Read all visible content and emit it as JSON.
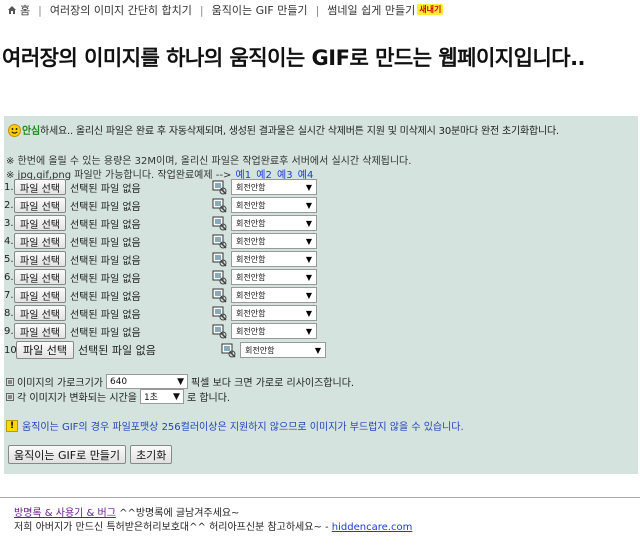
{
  "nav": {
    "items": [
      "홈",
      "여러장의 이미지 간단히 합치기",
      "움직이는 GIF 만들기",
      "썸네일 쉽게 만들기"
    ],
    "separator": "|",
    "badge": "새내기"
  },
  "headline": "여러장의 이미지를 하나의 움직이는 GIF로 만드는 웹페이지입니다..",
  "notice": {
    "greeting": "안심",
    "text": "하세요.. 올리신 파일은 완료 후 자동삭제되며, 생성된 결과물은 실시간 삭제버튼 지원 및 미삭제시 30분마다 완전 초기화합니다."
  },
  "info": {
    "line1": "※ 한번에 올릴 수 있는 용량은 32M이며, 올리신 파일은 작업완료후 서버에서 실시간 삭제됩니다.",
    "line2": "※ jpg,gif,png 파일만 가능합니다. 작업완료예제 -->",
    "examples": [
      "예1",
      "예2",
      "예3",
      "예4"
    ]
  },
  "file_rows": [
    {
      "num": "1.",
      "button": "파일 선택",
      "status": "선택된 파일 없음",
      "rotation": "회전안함"
    },
    {
      "num": "2.",
      "button": "파일 선택",
      "status": "선택된 파일 없음",
      "rotation": "회전안함"
    },
    {
      "num": "3.",
      "button": "파일 선택",
      "status": "선택된 파일 없음",
      "rotation": "회전안함"
    },
    {
      "num": "4.",
      "button": "파일 선택",
      "status": "선택된 파일 없음",
      "rotation": "회전안함"
    },
    {
      "num": "5.",
      "button": "파일 선택",
      "status": "선택된 파일 없음",
      "rotation": "회전안함"
    },
    {
      "num": "6.",
      "button": "파일 선택",
      "status": "선택된 파일 없음",
      "rotation": "회전안함"
    },
    {
      "num": "7.",
      "button": "파일 선택",
      "status": "선택된 파일 없음",
      "rotation": "회전안함"
    },
    {
      "num": "8.",
      "button": "파일 선택",
      "status": "선택된 파일 없음",
      "rotation": "회전안함"
    },
    {
      "num": "9.",
      "button": "파일 선택",
      "status": "선택된 파일 없음",
      "rotation": "회전안함"
    },
    {
      "num": "10",
      "button": "파일 선택",
      "status": "선택된 파일 없음",
      "rotation": "회전안함"
    }
  ],
  "options": {
    "width_prefix": "이미지의 가로크기가",
    "width_value": "640",
    "width_suffix": "픽셀 보다 크면 가로로 리사이즈합니다.",
    "interval_prefix": "각 이미지가 변화되는 시간을",
    "interval_value": "1초",
    "interval_suffix": "로 합니다."
  },
  "warning": "움직이는 GIF의 경우 파일포맷상 256컬러이상은 지원하지 않으므로 이미지가 부드럽지 않을 수 있습니다.",
  "actions": {
    "create": "움직이는 GIF로 만들기",
    "reset": "초기화"
  },
  "footer": {
    "link1": "방명록 & 사용기 & 버그",
    "text1": " ^^방명록에 글남겨주세요~",
    "text2": "저희 아버지가 만드신 특허받은허리보호대^^ 허리아프신분 참고하세요~ - ",
    "link2": "hiddencare.com"
  },
  "colors": {
    "panel": "#d4e3de",
    "warning_text": "#2244bb",
    "greeting": "#1e8b1e",
    "link": "#1a3bd6"
  }
}
